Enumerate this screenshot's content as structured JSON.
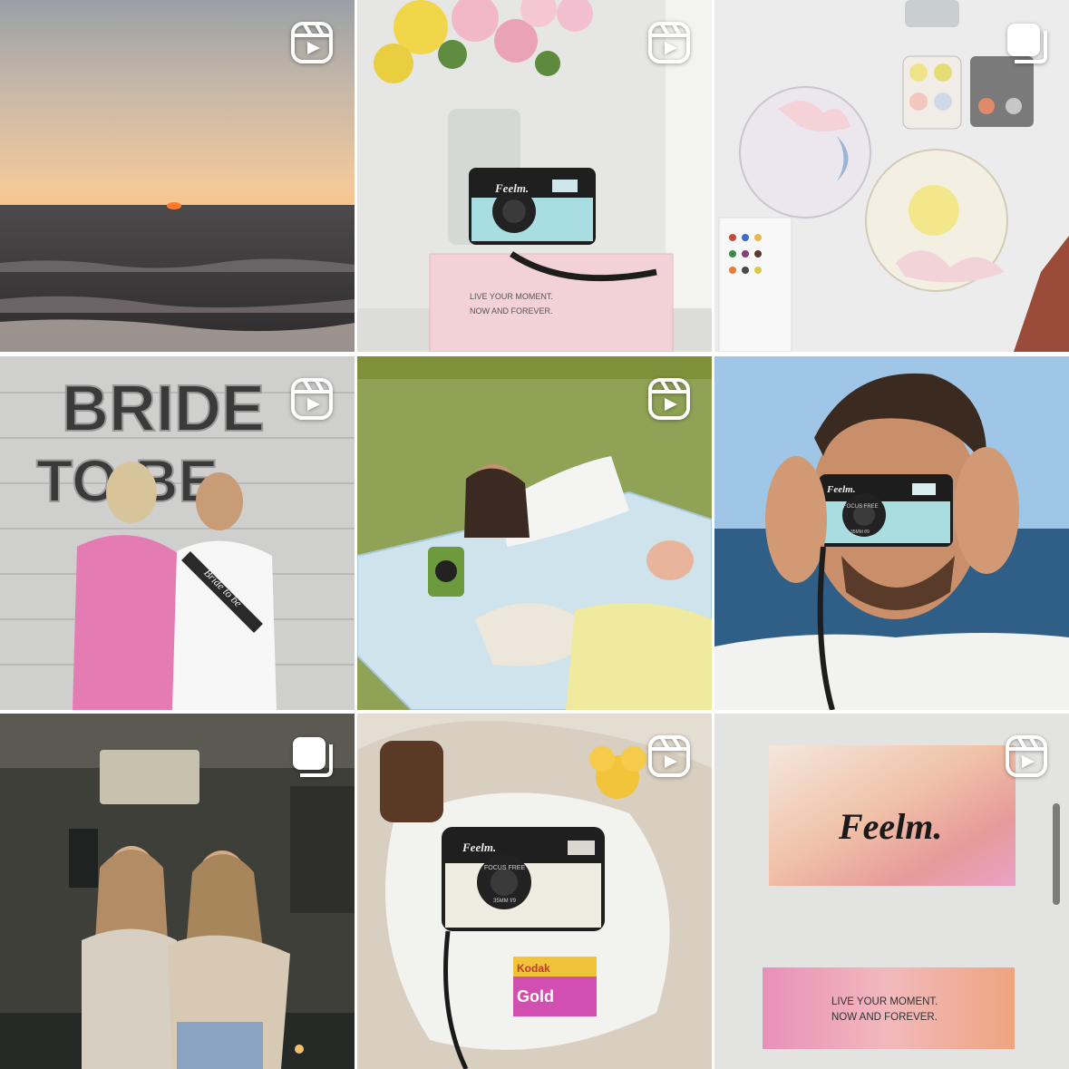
{
  "posts": [
    {
      "type": "reel",
      "icon": "reels-icon",
      "scene": "sunset over sea"
    },
    {
      "type": "reel",
      "icon": "reels-icon",
      "brand": "Feelm.",
      "box_line1": "LIVE YOUR MOMENT.",
      "box_line2": "NOW AND FOREVER."
    },
    {
      "type": "carousel",
      "icon": "carousel-icon",
      "scene": "painted coasters"
    },
    {
      "type": "reel",
      "icon": "reels-icon",
      "balloon_line1": "BRIDE",
      "balloon_line2": "TO BE",
      "sash": "Bride to be"
    },
    {
      "type": "reel",
      "icon": "reels-icon",
      "scene": "picnic with camera"
    },
    {
      "type": "image",
      "icon": "",
      "brand": "Feelm.",
      "lens": "FOCUS FREE",
      "lens_sub": "35MM f/9"
    },
    {
      "type": "carousel",
      "icon": "carousel-icon",
      "scene": "two friends at night"
    },
    {
      "type": "reel",
      "icon": "reels-icon",
      "brand": "Feelm.",
      "lens": "FOCUS FREE",
      "lens_sub": "35MM f/9",
      "film_brand": "Kodak",
      "film_name": "Gold"
    },
    {
      "type": "reel",
      "icon": "reels-icon",
      "brand": "Feelm.",
      "box_line1": "LIVE YOUR MOMENT.",
      "box_line2": "NOW AND FOREVER."
    }
  ],
  "colors": {
    "badge": "#ffffff",
    "camera_teal": "#a9dde0",
    "camera_cream": "#efece1"
  }
}
